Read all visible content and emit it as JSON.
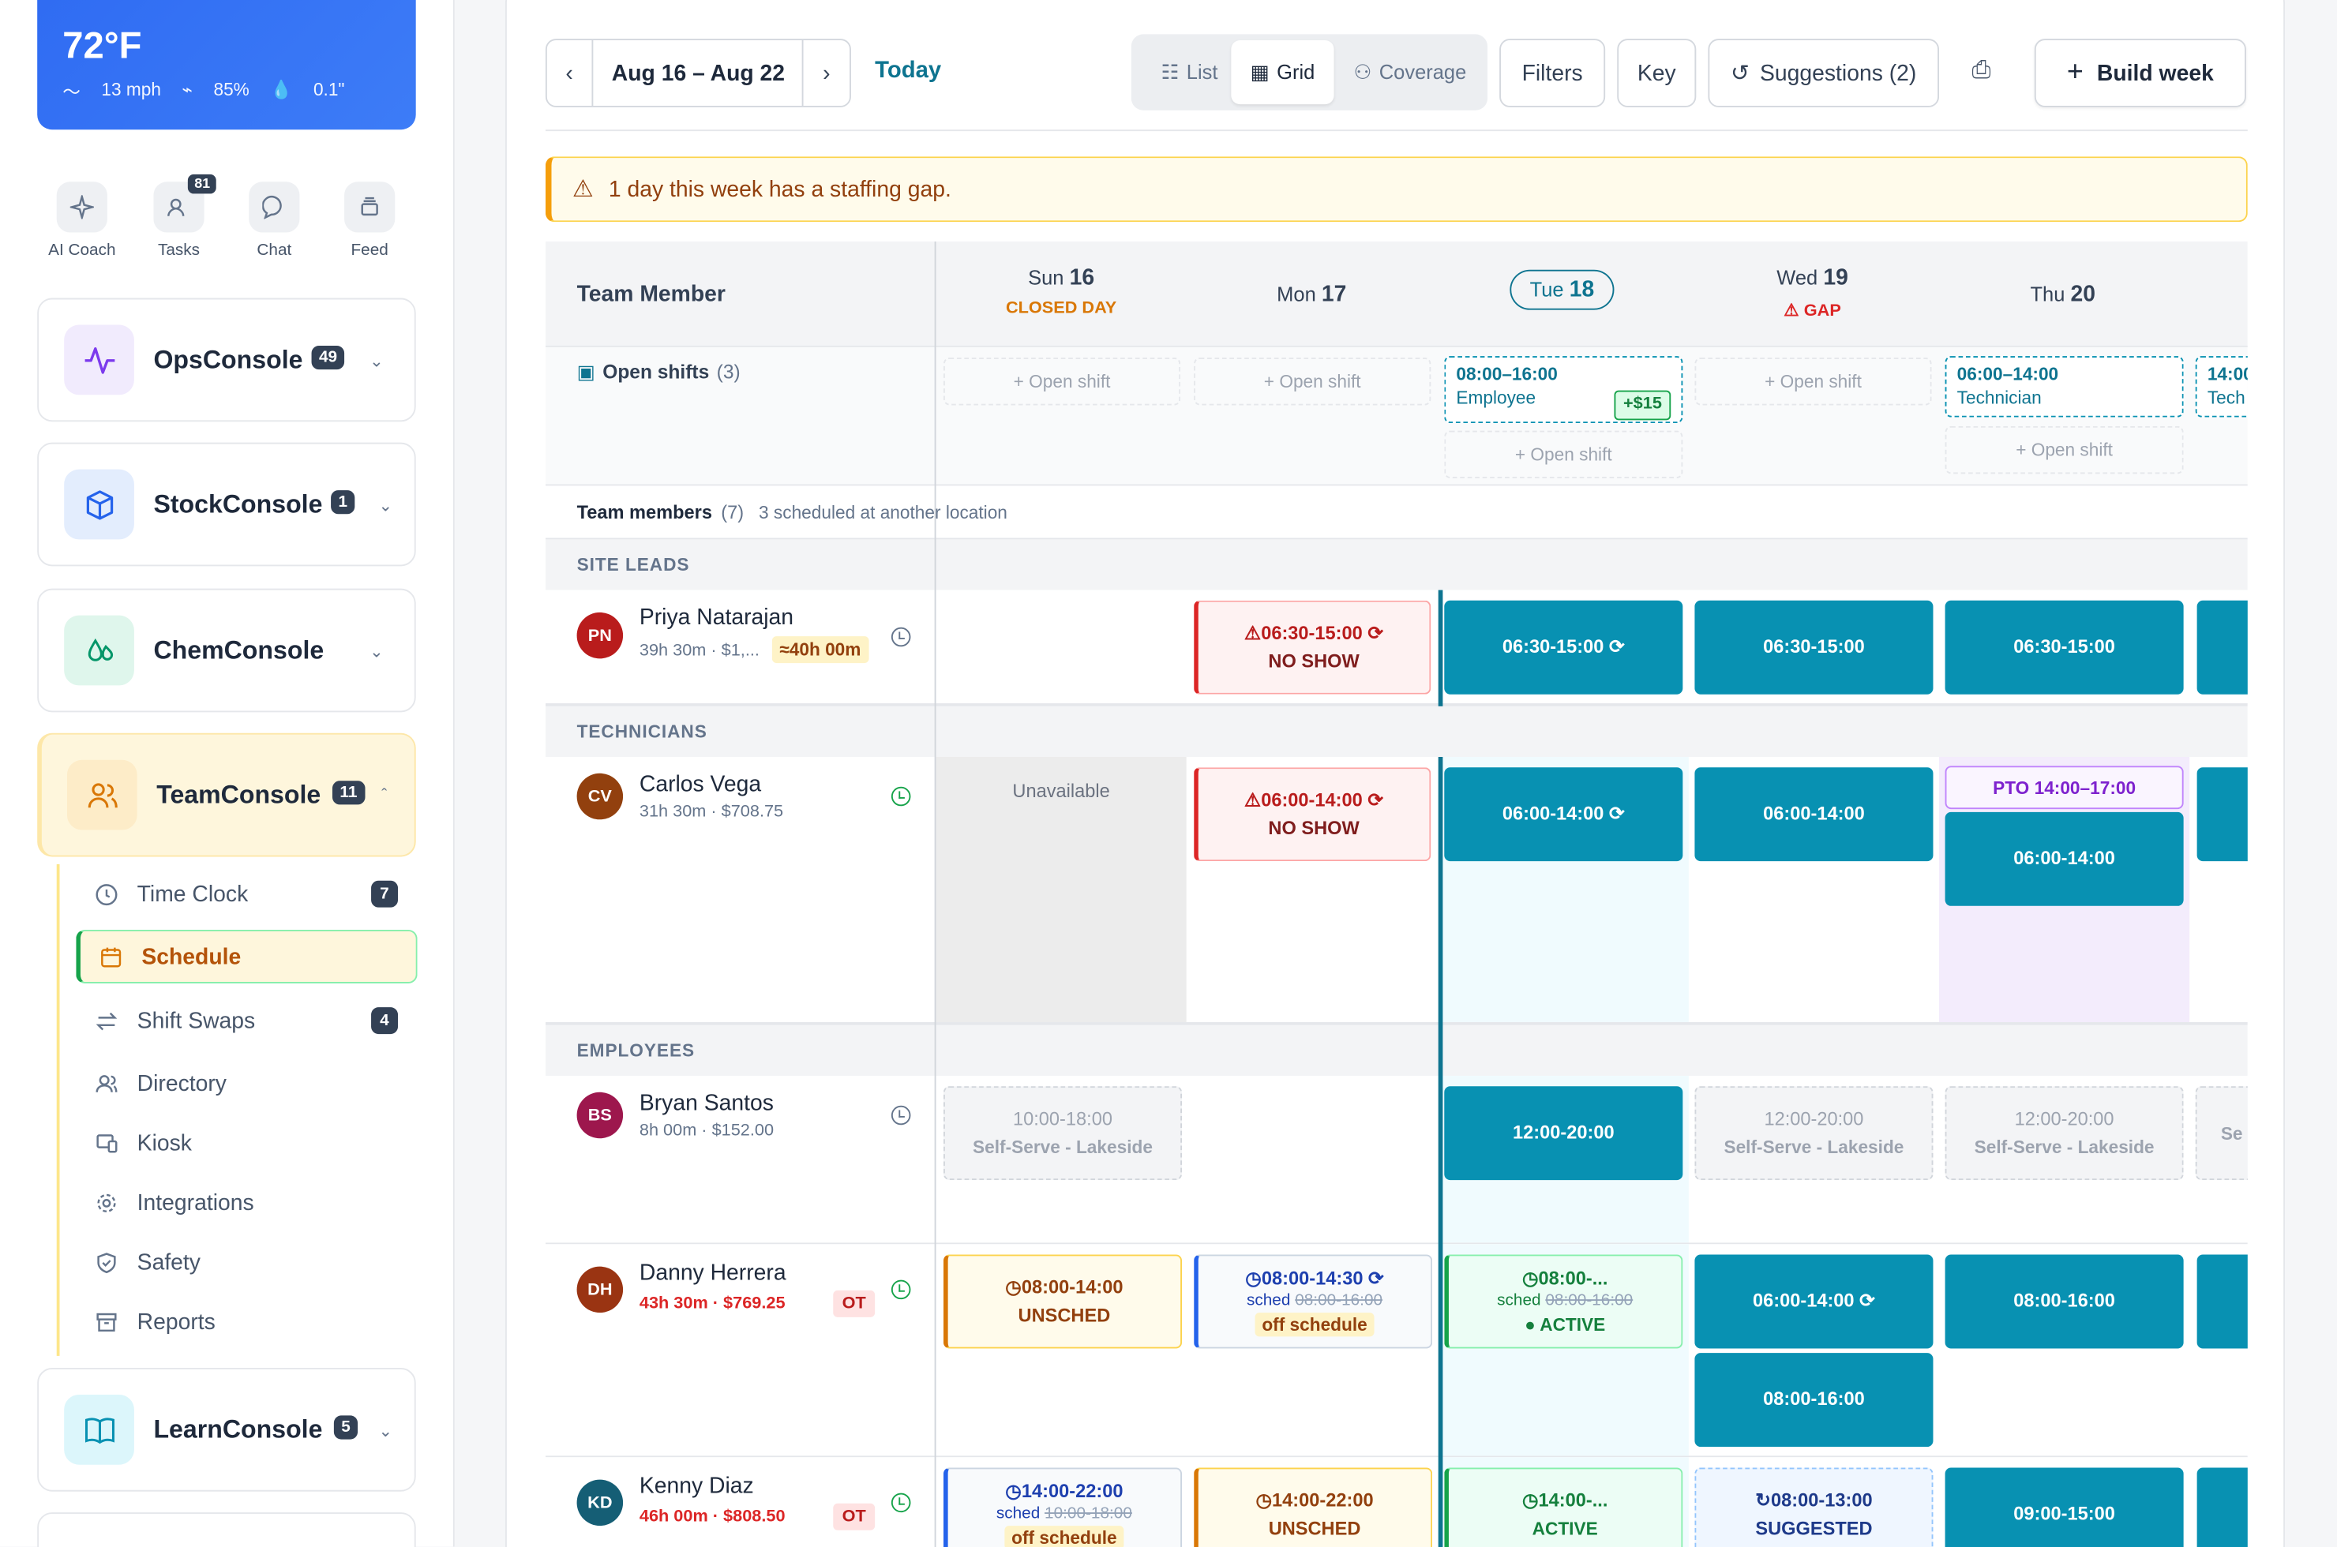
{
  "weather": {
    "temp": "72°F",
    "wind": "13 mph",
    "humidity": "85%",
    "precip": "0.1\""
  },
  "quick_actions": [
    {
      "label": "AI Coach",
      "icon": "sparkle-icon"
    },
    {
      "label": "Tasks",
      "icon": "tasks-icon",
      "badge": "81"
    },
    {
      "label": "Chat",
      "icon": "chat-icon"
    },
    {
      "label": "Feed",
      "icon": "feed-icon"
    }
  ],
  "consoles": [
    {
      "name": "OpsConsole",
      "badge": "49",
      "icon": "pulse-icon",
      "color": "#7c3aed",
      "bg": "#f1ebfd"
    },
    {
      "name": "StockConsole",
      "badge": "1",
      "icon": "box-icon",
      "color": "#2563eb",
      "bg": "#e3edfd"
    },
    {
      "name": "ChemConsole",
      "badge": "",
      "icon": "drops-icon",
      "color": "#059669",
      "bg": "#dff6ec"
    },
    {
      "name": "TeamConsole",
      "badge": "11",
      "icon": "users-icon",
      "color": "#d97706",
      "bg": "#fdecc8"
    },
    {
      "name": "LearnConsole",
      "badge": "5",
      "icon": "book-icon",
      "color": "#0891b2",
      "bg": "#dcf6fb"
    }
  ],
  "team_menu": [
    {
      "label": "Time Clock",
      "badge": "7",
      "icon": "clock-icon"
    },
    {
      "label": "Schedule",
      "badge": "",
      "icon": "calendar-icon"
    },
    {
      "label": "Shift Swaps",
      "badge": "4",
      "icon": "swap-icon"
    },
    {
      "label": "Directory",
      "badge": "",
      "icon": "people-icon"
    },
    {
      "label": "Kiosk",
      "badge": "",
      "icon": "kiosk-icon"
    },
    {
      "label": "Integrations",
      "badge": "",
      "icon": "gear-icon"
    },
    {
      "label": "Safety",
      "badge": "",
      "icon": "shield-icon"
    },
    {
      "label": "Reports",
      "badge": "",
      "icon": "archive-icon"
    }
  ],
  "toolbar": {
    "prev": "‹",
    "next": "›",
    "range": "Aug 16 – Aug 22",
    "today": "Today",
    "views": [
      "List",
      "Grid",
      "Coverage"
    ],
    "filters": "Filters",
    "key": "Key",
    "suggestions": "Suggestions (2)",
    "build": "Build week"
  },
  "alert": "1 day this week has a staffing gap.",
  "grid": {
    "member_header": "Team Member",
    "days": [
      {
        "dow": "Sun",
        "num": "16",
        "note": "CLOSED DAY",
        "note_color": "#d97706"
      },
      {
        "dow": "Mon",
        "num": "17",
        "note": ""
      },
      {
        "dow": "Tue",
        "num": "18",
        "note": "",
        "today": true
      },
      {
        "dow": "Wed",
        "num": "19",
        "note": "⚠ GAP",
        "note_color": "#dc2626"
      },
      {
        "dow": "Thu",
        "num": "20",
        "note": ""
      }
    ],
    "open_shifts": {
      "label": "Open shifts",
      "count": "(3)",
      "add": "+ Open shift",
      "tue": {
        "time": "08:00–16:00",
        "role": "Employee",
        "bonus": "+$15"
      },
      "thu": {
        "time": "06:00–14:00",
        "role": "Technician"
      },
      "fri": {
        "time": "14:00",
        "role": "Tech"
      }
    },
    "team_members": {
      "label": "Team members",
      "count": "(7)",
      "note": "3 scheduled at another location"
    },
    "sections": {
      "leads": "SITE LEADS",
      "techs": "TECHNICIANS",
      "emps": "EMPLOYEES"
    },
    "members": {
      "priya": {
        "initials": "PN",
        "name": "Priya Natarajan",
        "sub": "39h 30m · $1,...",
        "tag": "≈40h 00m"
      },
      "carlos": {
        "initials": "CV",
        "name": "Carlos Vega",
        "sub": "31h 30m · $708.75"
      },
      "bryan": {
        "initials": "BS",
        "name": "Bryan Santos",
        "sub": "8h 00m · $152.00"
      },
      "danny": {
        "initials": "DH",
        "name": "Danny Herrera",
        "sub": "43h 30m · $769.25",
        "ot": "OT"
      },
      "kenny": {
        "initials": "KD",
        "name": "Kenny Diaz",
        "sub": "46h 00m · $808.50",
        "ot": "OT"
      }
    },
    "shifts": {
      "priya_mon": {
        "time": "⚠06:30-15:00 ⟳",
        "status": "NO SHOW"
      },
      "priya_tue": "06:30-15:00 ⟳",
      "priya_wed": "06:30-15:00",
      "priya_thu": "06:30-15:00",
      "carlos_sun": "Unavailable",
      "carlos_mon": {
        "time": "⚠06:00-14:00 ⟳",
        "status": "NO SHOW"
      },
      "carlos_tue": "06:00-14:00 ⟳",
      "carlos_wed": "06:00-14:00",
      "carlos_pto": "PTO 14:00–17:00",
      "carlos_thu": "06:00-14:00",
      "bryan_sun": {
        "time": "10:00-18:00",
        "loc": "Self-Serve - Lakeside"
      },
      "bryan_tue": "12:00-20:00",
      "bryan_wed": {
        "time": "12:00-20:00",
        "loc": "Self-Serve - Lakeside"
      },
      "bryan_thu": {
        "time": "12:00-20:00",
        "loc": "Self-Serve - Lakeside"
      },
      "bryan_fri": "Se",
      "danny_sun": {
        "time": "◷08:00-14:00",
        "status": "UNSCHED"
      },
      "danny_mon": {
        "time": "◷08:00-14:30 ⟳",
        "sched": "sched",
        "sched_time": "08:00-16:00",
        "tag": "off schedule"
      },
      "danny_tue": {
        "time": "◷08:00-...",
        "sched": "sched",
        "sched_time": "08:00-16:00",
        "status": "● ACTIVE"
      },
      "danny_wed1": "06:00-14:00 ⟳",
      "danny_wed2": "08:00-16:00",
      "danny_thu": "08:00-16:00",
      "kenny_sun": {
        "time": "◷14:00-22:00",
        "sched": "sched",
        "sched_time": "10:00-18:00",
        "tag": "off schedule"
      },
      "kenny_mon": {
        "time": "◷14:00-22:00",
        "status": "UNSCHED"
      },
      "kenny_tue": {
        "time": "◷14:00-...",
        "status": "ACTIVE"
      },
      "kenny_wed": {
        "time": "↻08:00-13:00",
        "status": "SUGGESTED"
      },
      "kenny_thu": "09:00-15:00"
    }
  }
}
